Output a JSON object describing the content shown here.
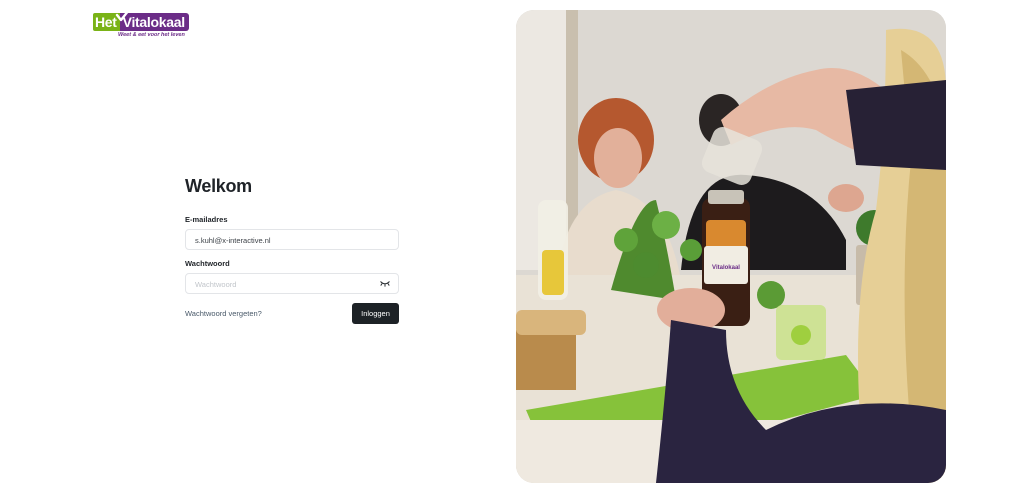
{
  "logo": {
    "het": "Het",
    "vital": "Vitalokaal",
    "tagline": "Weet & eet voor het leven"
  },
  "login": {
    "title": "Welkom",
    "email_label": "E-mailadres",
    "email_value": "s.kuhl@x-interactive.nl",
    "password_label": "Wachtwoord",
    "password_placeholder": "Wachtwoord",
    "forgot_label": "Wachtwoord vergeten?",
    "submit_label": "Inloggen"
  },
  "photo": {
    "jar_label": "Vitalokaal"
  },
  "colors": {
    "brand_green": "#7ab317",
    "brand_purple": "#6b2c87",
    "button_dark": "#1d2226"
  },
  "icons": {
    "password_toggle": "eye-off-icon"
  }
}
